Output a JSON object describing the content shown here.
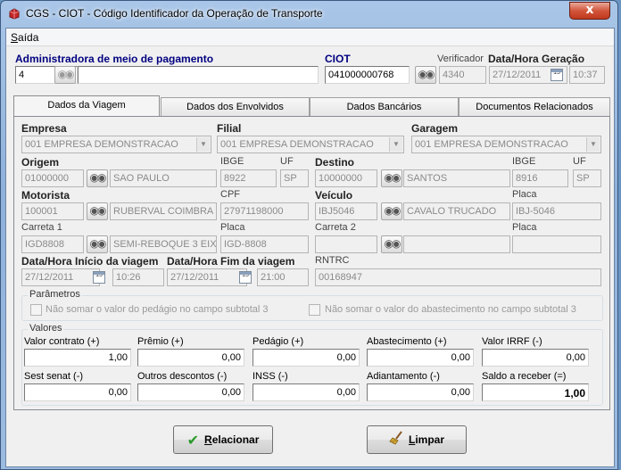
{
  "window": {
    "title": "CGS - CIOT - Código Identificador da Operação de Transporte",
    "close_glyph": "x"
  },
  "menu": {
    "items": [
      {
        "label": "Saída",
        "accel": "S",
        "rest": "aída"
      }
    ]
  },
  "header": {
    "adm_label": "Administradora de meio de pagamento",
    "adm_code": "4",
    "adm_name": "",
    "ciot_label": "CIOT",
    "ciot_value": "041000000768",
    "verificador_label": "Verificador",
    "verificador_value": "4340",
    "datahora_label": "Data/Hora Geração",
    "data_value": "27/12/2011",
    "hora_value": "10:37"
  },
  "tabs": [
    {
      "label": "Dados da Viagem",
      "active": true
    },
    {
      "label": "Dados dos Envolvidos",
      "active": false
    },
    {
      "label": "Dados Bancários",
      "active": false
    },
    {
      "label": "Documentos Relacionados",
      "active": false
    }
  ],
  "viagem": {
    "empresa_label": "Empresa",
    "empresa_value": "001 EMPRESA DEMONSTRACAO",
    "filial_label": "Filial",
    "filial_value": "001 EMPRESA DEMONSTRACAO",
    "garagem_label": "Garagem",
    "garagem_value": "001 EMPRESA DEMONSTRACAO",
    "origem_label": "Origem",
    "origem_code": "01000000",
    "origem_name": "SAO PAULO",
    "ibge_label": "IBGE",
    "origem_ibge": "8922",
    "uf_label": "UF",
    "origem_uf": "SP",
    "destino_label": "Destino",
    "destino_code": "10000000",
    "destino_name": "SANTOS",
    "destino_ibge": "8916",
    "destino_uf": "SP",
    "motorista_label": "Motorista",
    "motorista_code": "100001",
    "motorista_name": "RUBERVAL COIMBRA",
    "cpf_label": "CPF",
    "cpf_value": "27971198000",
    "veiculo_label": "Veículo",
    "veiculo_code": "IBJ5046",
    "veiculo_name": "CAVALO TRUCADO",
    "placa_label": "Placa",
    "veiculo_placa": "IBJ-5046",
    "carreta1_label": "Carreta 1",
    "carreta1_code": "IGD8808",
    "carreta1_name": "SEMI-REBOQUE 3 EIX",
    "carreta1_placa": "IGD-8808",
    "carreta2_label": "Carreta 2",
    "carreta2_code": "",
    "carreta2_name": "",
    "carreta2_placa": "",
    "inicio_label": "Data/Hora Início da viagem",
    "inicio_data": "27/12/2011",
    "inicio_hora": "10:26",
    "fim_label": "Data/Hora Fim da viagem",
    "fim_data": "27/12/2011",
    "fim_hora": "21:00",
    "rntrc_label": "RNTRC",
    "rntrc_value": "00168947",
    "cal_glyph": "15"
  },
  "parametros": {
    "title": "Parâmetros",
    "chk1": "Não somar o valor do pedágio no campo subtotal 3",
    "chk2": "Não somar o valor do abastecimento no campo subtotal 3"
  },
  "valores": {
    "title": "Valores",
    "fields": [
      {
        "label": "Valor contrato (+)",
        "value": "1,00"
      },
      {
        "label": "Prêmio (+)",
        "value": "0,00"
      },
      {
        "label": "Pedágio (+)",
        "value": "0,00"
      },
      {
        "label": "Abastecimento (+)",
        "value": "0,00"
      },
      {
        "label": "Valor IRRF (-)",
        "value": "0,00"
      },
      {
        "label": "Sest senat (-)",
        "value": "0,00"
      },
      {
        "label": "Outros descontos (-)",
        "value": "0,00"
      },
      {
        "label": "INSS (-)",
        "value": "0,00"
      },
      {
        "label": "Adiantamento (-)",
        "value": "0,00"
      },
      {
        "label": "Saldo a receber (=)",
        "value": "1,00"
      }
    ]
  },
  "buttons": {
    "relacionar": {
      "accel": "R",
      "rest": "elacionar",
      "icon": "check-icon"
    },
    "limpar": {
      "accel": "L",
      "rest": "impar",
      "icon": "broom-icon"
    }
  },
  "colors": {
    "title_accent": "#000080",
    "check_green": "#2a9a2a"
  }
}
